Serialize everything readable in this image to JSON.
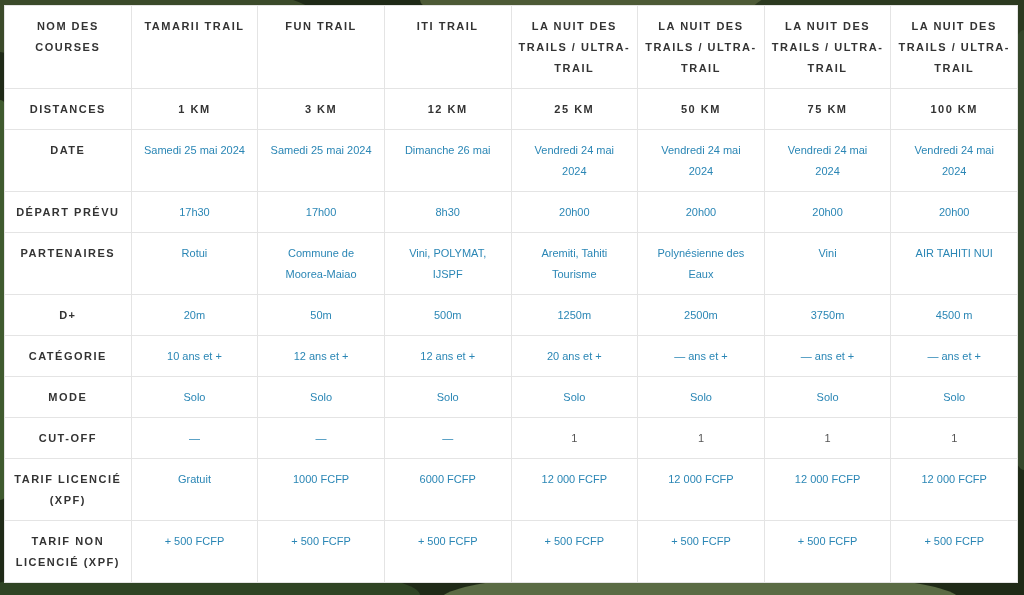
{
  "table": {
    "corner": "NOM DES COURSES",
    "columns": [
      "TAMARII TRAIL",
      "FUN TRAIL",
      "ITI TRAIL",
      "LA NUIT DES TRAILS / ULTRA-TRAIL",
      "LA NUIT DES TRAILS / ULTRA-TRAIL",
      "LA NUIT DES TRAILS / ULTRA-TRAIL",
      "LA NUIT DES TRAILS / ULTRA-TRAIL"
    ],
    "rows": [
      {
        "label": "DISTANCES",
        "cells": [
          {
            "text": "1 KM",
            "kind": "heading"
          },
          {
            "text": "3 KM",
            "kind": "heading"
          },
          {
            "text": "12 KM",
            "kind": "heading"
          },
          {
            "text": "25 KM",
            "kind": "heading"
          },
          {
            "text": "50 KM",
            "kind": "heading"
          },
          {
            "text": "75 KM",
            "kind": "heading"
          },
          {
            "text": "100 KM",
            "kind": "heading"
          }
        ]
      },
      {
        "label": "DATE",
        "cells": [
          {
            "text": "Samedi 25 mai 2024",
            "kind": "link"
          },
          {
            "text": "Samedi 25 mai 2024",
            "kind": "link"
          },
          {
            "text": "Dimanche 26 mai",
            "kind": "link"
          },
          {
            "text": "Vendredi 24 mai 2024",
            "kind": "link"
          },
          {
            "text": "Vendredi 24 mai 2024",
            "kind": "link"
          },
          {
            "text": "Vendredi 24 mai 2024",
            "kind": "link"
          },
          {
            "text": "Vendredi 24 mai 2024",
            "kind": "link"
          }
        ]
      },
      {
        "label": "DÉPART PRÉVU",
        "cells": [
          {
            "text": "17h30",
            "kind": "link"
          },
          {
            "text": "17h00",
            "kind": "link"
          },
          {
            "text": "8h30",
            "kind": "link"
          },
          {
            "text": "20h00",
            "kind": "link"
          },
          {
            "text": "20h00",
            "kind": "link"
          },
          {
            "text": "20h00",
            "kind": "link"
          },
          {
            "text": "20h00",
            "kind": "link"
          }
        ]
      },
      {
        "label": "PARTENAIRES",
        "cells": [
          {
            "text": "Rotui",
            "kind": "link"
          },
          {
            "text": "Commune de Moorea-Maiao",
            "kind": "link"
          },
          {
            "text": "Vini, POLYMAT, IJSPF",
            "kind": "link"
          },
          {
            "text": "Aremiti, Tahiti Tourisme",
            "kind": "link"
          },
          {
            "text": "Polynésienne des Eaux",
            "kind": "link"
          },
          {
            "text": "Vini",
            "kind": "link"
          },
          {
            "text": "AIR TAHITI NUI",
            "kind": "link"
          }
        ]
      },
      {
        "label": "D+",
        "cells": [
          {
            "text": "20m",
            "kind": "link"
          },
          {
            "text": "50m",
            "kind": "link"
          },
          {
            "text": "500m",
            "kind": "link"
          },
          {
            "text": "1250m",
            "kind": "link"
          },
          {
            "text": "2500m",
            "kind": "link"
          },
          {
            "text": "3750m",
            "kind": "link"
          },
          {
            "text": "4500 m",
            "kind": "link"
          }
        ]
      },
      {
        "label": "CATÉGORIE",
        "cells": [
          {
            "text": "10 ans et +",
            "kind": "link"
          },
          {
            "text": "12 ans et +",
            "kind": "link"
          },
          {
            "text": "12 ans et +",
            "kind": "link"
          },
          {
            "text": "20 ans et +",
            "kind": "link"
          },
          {
            "text": "— ans et +",
            "kind": "link"
          },
          {
            "text": "— ans et +",
            "kind": "link"
          },
          {
            "text": "— ans et +",
            "kind": "link"
          }
        ]
      },
      {
        "label": "MODE",
        "cells": [
          {
            "text": "Solo",
            "kind": "link"
          },
          {
            "text": "Solo",
            "kind": "link"
          },
          {
            "text": "Solo",
            "kind": "link"
          },
          {
            "text": "Solo",
            "kind": "link"
          },
          {
            "text": "Solo",
            "kind": "link"
          },
          {
            "text": "Solo",
            "kind": "link"
          },
          {
            "text": "Solo",
            "kind": "link"
          }
        ]
      },
      {
        "label": "CUT-OFF",
        "cells": [
          {
            "text": "—",
            "kind": "link"
          },
          {
            "text": "—",
            "kind": "link"
          },
          {
            "text": "—",
            "kind": "link"
          },
          {
            "text": "1",
            "kind": "text"
          },
          {
            "text": "1",
            "kind": "text"
          },
          {
            "text": "1",
            "kind": "text"
          },
          {
            "text": "1",
            "kind": "text"
          }
        ]
      },
      {
        "label": "TARIF LICENCIÉ (XPF)",
        "cells": [
          {
            "text": "Gratuit",
            "kind": "link"
          },
          {
            "text": "1000 FCFP",
            "kind": "link"
          },
          {
            "text": "6000 FCFP",
            "kind": "link"
          },
          {
            "text": "12 000 FCFP",
            "kind": "link"
          },
          {
            "text": "12 000 FCFP",
            "kind": "link"
          },
          {
            "text": "12 000 FCFP",
            "kind": "link"
          },
          {
            "text": "12 000 FCFP",
            "kind": "link"
          }
        ]
      },
      {
        "label": "TARIF NON LICENCIÉ (XPF)",
        "cells": [
          {
            "text": "+ 500 FCFP",
            "kind": "link"
          },
          {
            "text": "+ 500 FCFP",
            "kind": "link"
          },
          {
            "text": "+ 500 FCFP",
            "kind": "link"
          },
          {
            "text": "+ 500 FCFP",
            "kind": "link"
          },
          {
            "text": "+ 500 FCFP",
            "kind": "link"
          },
          {
            "text": "+ 500 FCFP",
            "kind": "link"
          },
          {
            "text": "+ 500 FCFP",
            "kind": "link"
          }
        ]
      }
    ]
  }
}
